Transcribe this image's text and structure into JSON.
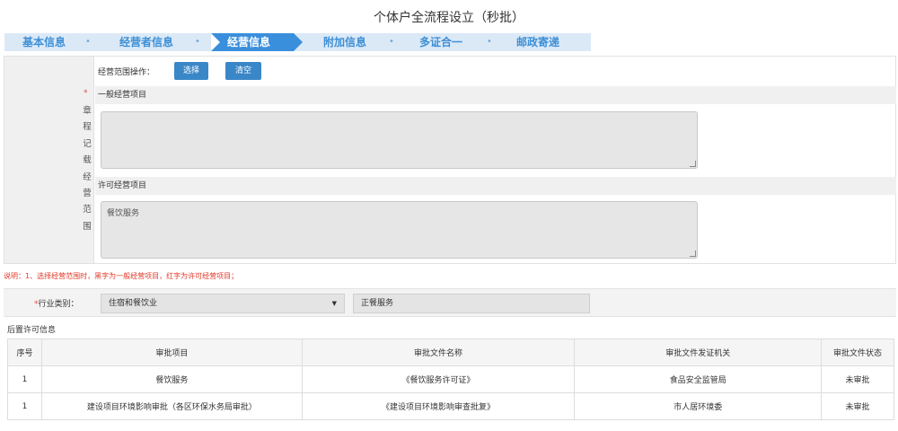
{
  "page": {
    "title": "个体户全流程设立（秒批）"
  },
  "steps": [
    {
      "label": "基本信息"
    },
    {
      "label": "经营者信息"
    },
    {
      "label": "经营信息"
    },
    {
      "label": "附加信息"
    },
    {
      "label": "多证合一"
    },
    {
      "label": "邮政寄递"
    }
  ],
  "step_separator": "•",
  "scope": {
    "required_mark": "*",
    "side_label": [
      "章",
      "程",
      "记",
      "载",
      "经",
      "营",
      "范",
      "围"
    ],
    "op_label": "经营范围操作：",
    "select_button": "选择",
    "clear_button": "清空",
    "general_label": "一般经营项目",
    "general_value": "",
    "licensed_label": "许可经营项目",
    "licensed_value": "餐饮服务"
  },
  "note": "说明：1、选择经营范围时，黑字为一般经营项目，红字为许可经营项目；",
  "industry": {
    "required_mark": "*",
    "label": "行业类别：",
    "selected": "住宿和餐饮业",
    "caret": "▼",
    "sub_value": "正餐服务"
  },
  "post_permit": {
    "title": "后置许可信息",
    "columns": [
      "序号",
      "审批项目",
      "审批文件名称",
      "审批文件发证机关",
      "审批文件状态"
    ],
    "rows": [
      [
        "1",
        "餐饮服务",
        "《餐饮服务许可证》",
        "食品安全监管局",
        "未审批"
      ],
      [
        "1",
        "建设项目环境影响审批（各区环保水务局审批）",
        "《建设项目环境影响审查批复》",
        "市人居环境委",
        "未审批"
      ]
    ]
  }
}
